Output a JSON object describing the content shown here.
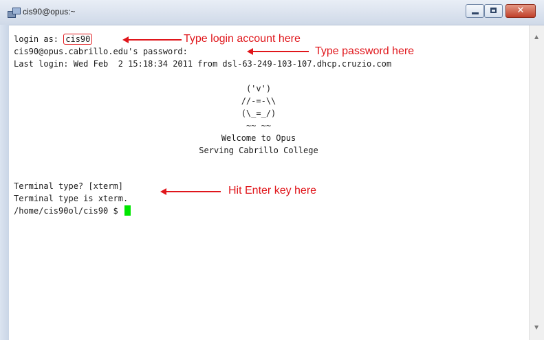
{
  "window": {
    "title": "cis90@opus:~",
    "controls": {
      "minimize": "minimize-icon",
      "maximize": "maximize-icon",
      "close": "close-icon"
    }
  },
  "terminal": {
    "lines": [
      "login as: ",
      "cis90@opus.cabrillo.edu's password:",
      "Last login: Wed Feb  2 15:18:34 2011 from dsl-63-249-103-107.dhcp.cruzio.com"
    ],
    "login_value": "cis90",
    "banner": [
      "('v')",
      "//-=-\\\\",
      "(\\_=_/)",
      "~~ ~~",
      "Welcome to Opus",
      "Serving Cabrillo College"
    ],
    "term_prompt": "Terminal type? [xterm]",
    "term_result": "Terminal type is xterm.",
    "shell_prompt": "/home/cis90ol/cis90 $ "
  },
  "annotations": {
    "login": "Type login account here",
    "password": "Type password here",
    "enter": "Hit Enter key here"
  },
  "colors": {
    "annotation": "#e0161b",
    "cursor": "#00e600"
  }
}
